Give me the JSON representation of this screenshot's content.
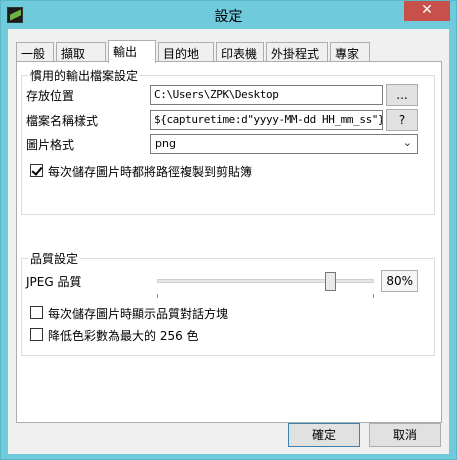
{
  "window": {
    "title": "設定",
    "close_label": "✕"
  },
  "tabs": [
    {
      "label": "一般"
    },
    {
      "label": "擷取"
    },
    {
      "label": "輸出"
    },
    {
      "label": "目的地"
    },
    {
      "label": "印表機"
    },
    {
      "label": "外掛程式"
    },
    {
      "label": "專家"
    }
  ],
  "output": {
    "group_title": "慣用的輸出檔案設定",
    "storage_label": "存放位置",
    "storage_value": "C:\\Users\\ZPK\\Desktop",
    "browse_label": "...",
    "filename_label": "檔案名稱樣式",
    "filename_value": "${capturetime:d\"yyyy-MM-dd HH_mm_ss\"}-${title}",
    "help_label": "?",
    "format_label": "圖片格式",
    "format_value": "png",
    "copy_path_label": "每次儲存圖片時都將路徑複製到剪貼簿",
    "copy_path_checked": true
  },
  "quality": {
    "group_title": "品質設定",
    "jpeg_label": "JPEG 品質",
    "jpeg_value": "80%",
    "jpeg_fraction": 0.8,
    "show_dialog_label": "每次儲存圖片時顯示品質對話方塊",
    "show_dialog_checked": false,
    "reduce_colors_label": "降低色彩數為最大的 256 色",
    "reduce_colors_checked": false
  },
  "footer": {
    "ok_label": "確定",
    "cancel_label": "取消"
  }
}
